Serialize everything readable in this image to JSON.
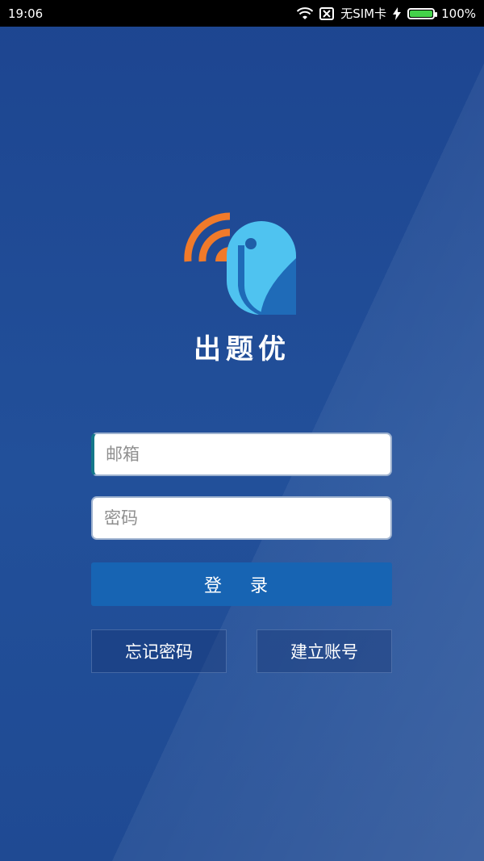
{
  "status_bar": {
    "time": "19:06",
    "carrier": "无SIM卡",
    "battery_percent": "100%",
    "battery_level": 1.0,
    "icons": [
      "wifi-icon",
      "no-sim-icon",
      "charging-icon",
      "battery-icon"
    ]
  },
  "app": {
    "name": "出题优",
    "logo_icon": "speech-bird-logo-icon"
  },
  "login_form": {
    "email_placeholder": "邮箱",
    "email_value": "",
    "password_placeholder": "密码",
    "password_value": "",
    "login_label": "登 录",
    "forgot_label": "忘记密码",
    "register_label": "建立账号"
  },
  "colors": {
    "background": "#1f4a93",
    "primary_button": "#1764b3",
    "logo_orange": "#f07a2a",
    "logo_light_blue": "#4fc3f0",
    "logo_dark_blue": "#1f6bb8"
  }
}
